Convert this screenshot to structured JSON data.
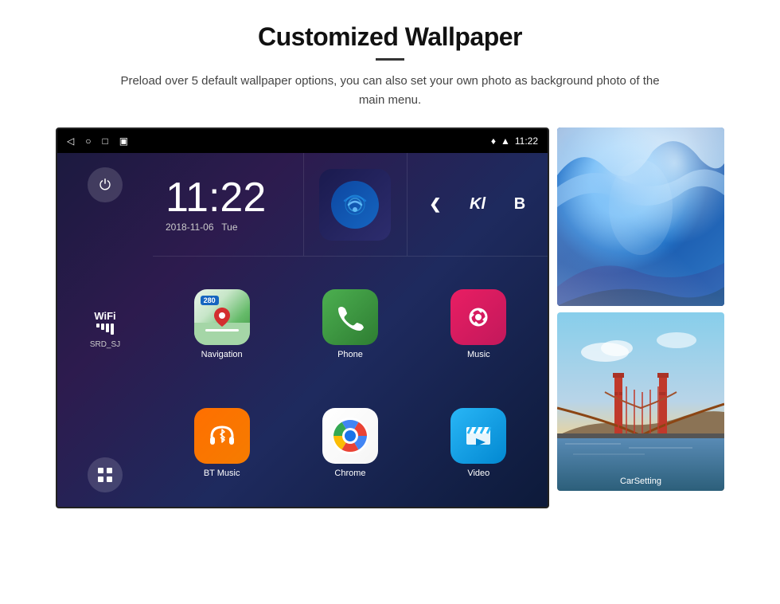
{
  "header": {
    "title": "Customized Wallpaper",
    "description": "Preload over 5 default wallpaper options, you can also set your own photo as background photo of the main menu."
  },
  "statusBar": {
    "time": "11:22",
    "icons": [
      "back-icon",
      "home-icon",
      "recent-icon",
      "screenshot-icon"
    ]
  },
  "clock": {
    "time": "11:22",
    "date": "2018-11-06",
    "day": "Tue"
  },
  "wifi": {
    "label": "WiFi",
    "ssid": "SRD_SJ"
  },
  "apps": [
    {
      "name": "Navigation",
      "icon": "navigation"
    },
    {
      "name": "Phone",
      "icon": "phone"
    },
    {
      "name": "Music",
      "icon": "music"
    },
    {
      "name": "BT Music",
      "icon": "bt-music"
    },
    {
      "name": "Chrome",
      "icon": "chrome"
    },
    {
      "name": "Video",
      "icon": "video"
    }
  ],
  "wallpapers": [
    {
      "name": "blue-ice",
      "label": ""
    },
    {
      "name": "golden-gate",
      "label": "CarSetting"
    }
  ],
  "mediaButtons": {
    "prev": "❮",
    "letter1": "Kl",
    "letter2": "B"
  }
}
